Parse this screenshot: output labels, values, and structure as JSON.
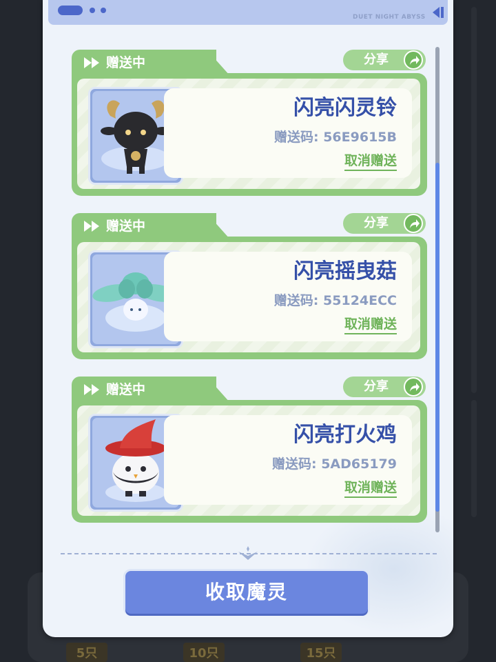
{
  "header": {
    "brand_text": "DUET NIGHT ABYSS"
  },
  "cards": [
    {
      "status": "赠送中",
      "share_label": "分享",
      "pet_name": "闪亮闪灵铃",
      "code_label": "赠送码:",
      "code": "56E9615B",
      "cancel_label": "取消赠送",
      "avatar": "black-goat-creature"
    },
    {
      "status": "赠送中",
      "share_label": "分享",
      "pet_name": "闪亮摇曳菇",
      "code_label": "赠送码:",
      "code": "55124ECC",
      "cancel_label": "取消赠送",
      "avatar": "teal-mushroom-creature"
    },
    {
      "status": "赠送中",
      "share_label": "分享",
      "pet_name": "闪亮打火鸡",
      "code_label": "赠送码:",
      "code": "5AD65179",
      "cancel_label": "取消赠送",
      "avatar": "red-hat-chick-creature"
    }
  ],
  "footer": {
    "collect_button": "收取魔灵"
  },
  "background": {
    "badges": [
      "5只",
      "10只",
      "15只"
    ]
  },
  "colors": {
    "card_green": "#8fc97d",
    "name_blue": "#3550a8",
    "button_blue": "#6b86df",
    "scroll_blue": "#5e87e6"
  }
}
